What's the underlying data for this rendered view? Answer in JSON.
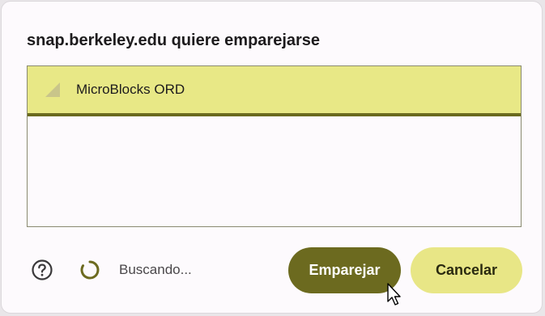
{
  "dialog": {
    "title": "snap.berkeley.edu quiere emparejarse"
  },
  "devices": [
    {
      "name": "MicroBlocks ORD",
      "selected": true,
      "icon": "signal-strength-icon"
    }
  ],
  "footer": {
    "help_icon": "help-circle-icon",
    "spinner_icon": "loading-spinner-icon",
    "status": "Buscando..."
  },
  "buttons": {
    "pair_label": "Emparejar",
    "cancel_label": "Cancelar"
  },
  "colors": {
    "selected_row": "#e8e886",
    "primary_button": "#6c6a1f",
    "secondary_button": "#e8e686",
    "accent_line": "#6a6a1e"
  }
}
